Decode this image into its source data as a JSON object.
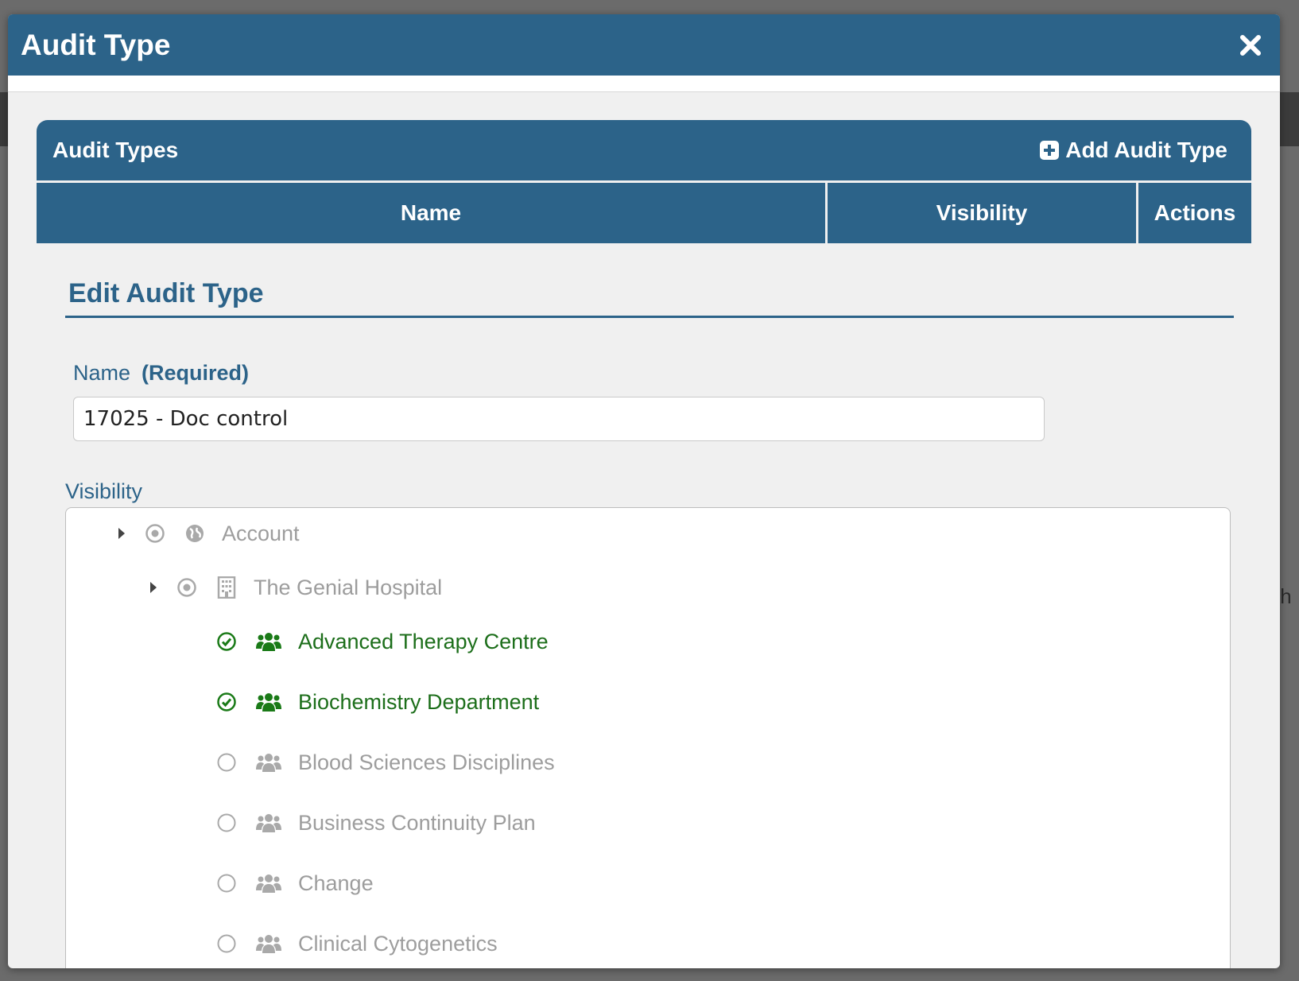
{
  "modal": {
    "title": "Audit Type"
  },
  "panel": {
    "title": "Audit Types",
    "add_label": "Add Audit Type",
    "columns": [
      "Name",
      "Visibility",
      "Actions"
    ]
  },
  "form": {
    "section_title": "Edit Audit Type",
    "name_label": "Name",
    "name_required": "(Required)",
    "name_value": "17025 - Doc control",
    "visibility_label": "Visibility"
  },
  "tree": {
    "account": "Account",
    "hospital": "The Genial Hospital",
    "departments": [
      {
        "label": "Advanced Therapy Centre",
        "selected": true
      },
      {
        "label": "Biochemistry Department",
        "selected": true
      },
      {
        "label": "Blood Sciences Disciplines",
        "selected": false
      },
      {
        "label": "Business Continuity Plan",
        "selected": false
      },
      {
        "label": "Change",
        "selected": false
      },
      {
        "label": "Clinical Cytogenetics",
        "selected": false
      }
    ]
  },
  "colors": {
    "primary": "#2c6389",
    "selected": "#1c6e1a",
    "unselected": "#9d9d9d"
  }
}
